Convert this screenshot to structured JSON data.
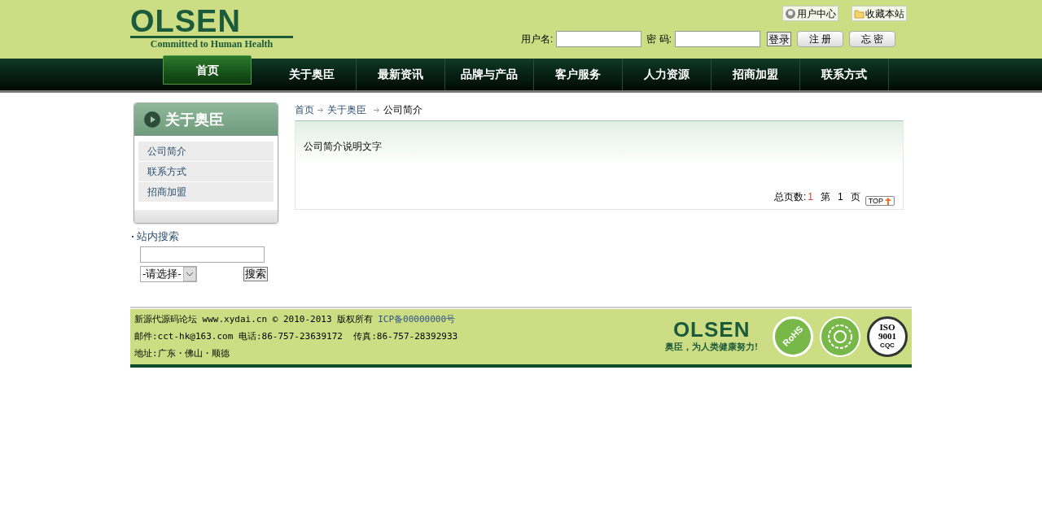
{
  "logo": {
    "name": "OLSEN",
    "tagline": "Committed to Human Health"
  },
  "top_links": [
    {
      "label": "用户中心",
      "kind": "user"
    },
    {
      "label": "收藏本站",
      "kind": "folder"
    }
  ],
  "login": {
    "username_label": "用户名:",
    "password_label": "密 码:",
    "login_button": "登录",
    "register_button": "注 册",
    "forgot_button": "忘 密"
  },
  "nav": [
    {
      "label": "首页",
      "selected": true
    },
    {
      "label": "关于奥臣",
      "selected": false
    },
    {
      "label": "最新资讯",
      "selected": false
    },
    {
      "label": "品牌与产品",
      "selected": false
    },
    {
      "label": "客户服务",
      "selected": false
    },
    {
      "label": "人力资源",
      "selected": false
    },
    {
      "label": "招商加盟",
      "selected": false
    },
    {
      "label": "联系方式",
      "selected": false
    }
  ],
  "sidebar": {
    "title": "关于奥臣",
    "items": [
      "公司简介",
      "联系方式",
      "招商加盟"
    ]
  },
  "site_search": {
    "title": "站内搜索",
    "select": "-请选择-",
    "button": "搜索"
  },
  "breadcrumb": [
    "首页",
    "关于奥臣",
    "公司简介"
  ],
  "content": {
    "text": "公司简介说明文字",
    "pager": {
      "total_label": "总页数:",
      "total": "1",
      "page_prefix": "第",
      "page": "1",
      "page_suffix": "页"
    },
    "top_button": "TOP"
  },
  "footer": {
    "lines": [
      "新源代源码论坛 www.xydai.cn © 2010-2013 版权所有",
      "邮件:cct-hk@163.com 电话:86-757-23639172  传真:86-757-28392933",
      "地址:广东・佛山・顺德"
    ],
    "icp_link": "ICP备00000000号",
    "logo": "OLSEN",
    "slogan": "奥臣，为人类健康努力!",
    "badges": [
      {
        "kind": "rohs",
        "text": "RoHS"
      },
      {
        "kind": "flower"
      },
      {
        "kind": "iso",
        "text": "ISO 9001",
        "sub": "CQC"
      }
    ]
  }
}
